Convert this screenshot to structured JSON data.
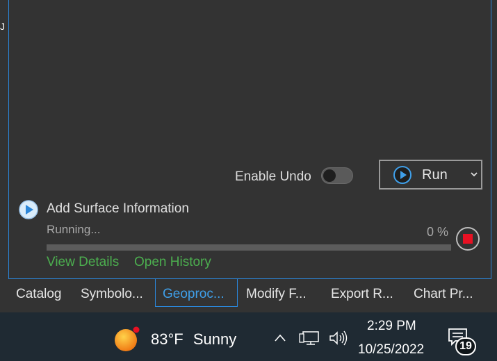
{
  "left_marker": "J",
  "options": {
    "enable_undo_label": "Enable Undo",
    "enable_undo_on": false
  },
  "run_button": {
    "label": "Run",
    "icon": "play-circle-icon",
    "dropdown_icon": "chevron-down-icon"
  },
  "task": {
    "icon": "play-circle-icon",
    "title": "Add Surface Information",
    "status": "Running...",
    "percent_text": "0 %",
    "progress_fraction": 0,
    "stop_icon": "stop-icon",
    "links": [
      "View Details",
      "Open History"
    ]
  },
  "tabs": [
    {
      "label": "Catalog",
      "active": false
    },
    {
      "label": "Symbolo...",
      "active": false
    },
    {
      "label": "Geoproc...",
      "active": true
    },
    {
      "label": "Modify F...",
      "active": false
    },
    {
      "label": "Export R...",
      "active": false
    },
    {
      "label": "Chart Pr...",
      "active": false
    }
  ],
  "taskbar": {
    "weather": {
      "icon": "sun-icon",
      "temperature": "83°F",
      "condition": "Sunny"
    },
    "tray_icons": [
      "chevron-up-icon",
      "network-icon",
      "volume-icon"
    ],
    "time": "2:29 PM",
    "date": "10/25/2022",
    "notifications_icon": "notification-icon",
    "notifications_count": "19"
  },
  "colors": {
    "panel_bg": "#333333",
    "accent": "#2b86d9",
    "link": "#4cae4f",
    "stop": "#e81123",
    "taskbar_bg": "#1f2a33"
  }
}
